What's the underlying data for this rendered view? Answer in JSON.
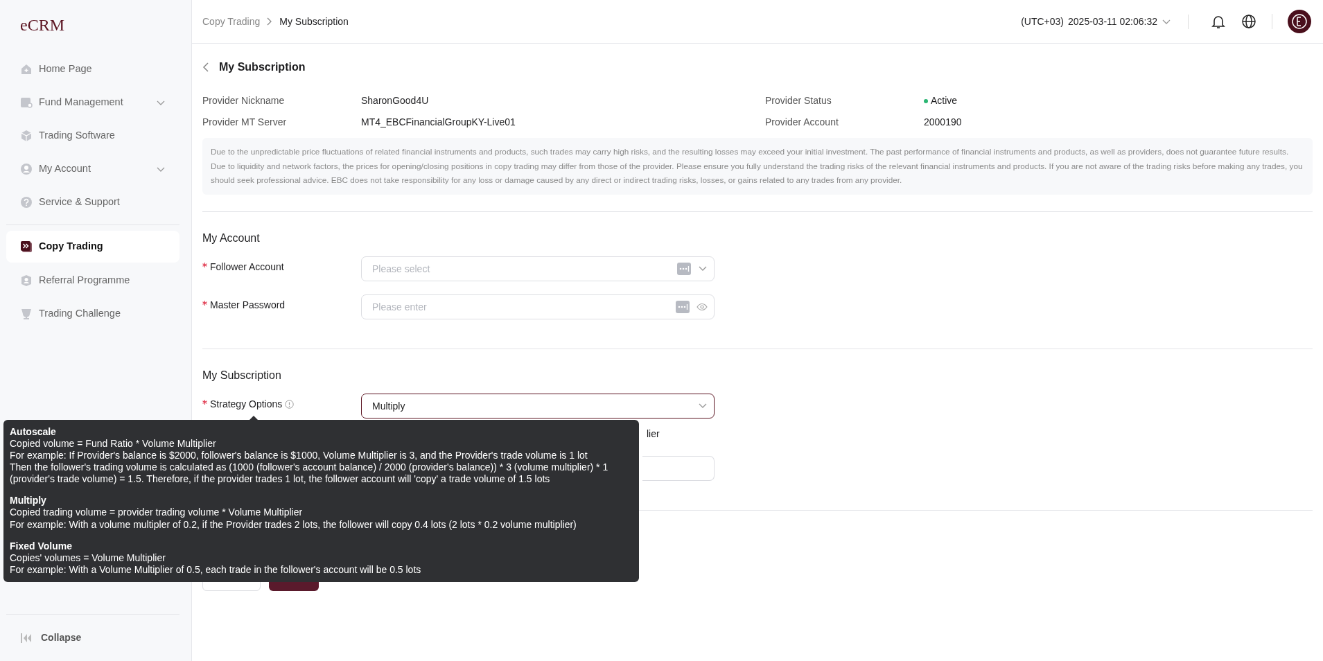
{
  "sidebar": {
    "logo": "eCRM",
    "items": [
      {
        "label": "Home Page",
        "expandable": false,
        "selected": false
      },
      {
        "label": "Fund Management",
        "expandable": true,
        "selected": false
      },
      {
        "label": "Trading Software",
        "expandable": false,
        "selected": false
      },
      {
        "label": "My Account",
        "expandable": true,
        "selected": false
      },
      {
        "label": "Service & Support",
        "expandable": false,
        "selected": false
      },
      {
        "label": "Copy Trading",
        "expandable": false,
        "selected": true
      },
      {
        "label": "Referral Programme",
        "expandable": false,
        "selected": false
      },
      {
        "label": "Trading Challenge",
        "expandable": false,
        "selected": false
      }
    ],
    "collapse": "Collapse"
  },
  "breadcrumb": [
    "Copy Trading",
    "My Subscription"
  ],
  "topbar": {
    "timezone": "(UTC+03)",
    "datetime": "2025-03-11 02:06:32"
  },
  "page_title": "My Subscription",
  "provider": [
    {
      "label": "Provider Nickname",
      "value": "SharonGood4U"
    },
    {
      "label": "Provider Status",
      "value": "Active",
      "color": "#2bb673"
    },
    {
      "label": "Provider MT Server",
      "value": "MT4_EBCFinancialGroupKY-Live01"
    },
    {
      "label": "Provider Account",
      "value": "2000190"
    }
  ],
  "disclaimer": "Due to the unpredictable price fluctuations of related financial instruments and products, such trades may carry high risks, and the resulting losses may exceed your initial investment. The past performance of financial instruments and products, as well as providers, does not guarantee future results. Due to liquidity and network factors, the prices for opening/closing positions in copy trading may differ from those of the provider. Please ensure you fully understand the trading risks of the relevant financial instruments and products. If you are not aware of the trading risks before making any trades, you should seek professional advice. EBC does not take responsibility for any loss or damage caused by any direct or indirect trading risks, losses, or gains related to any trades from any provider.",
  "account_section": {
    "title": "My Account",
    "fields": [
      {
        "label": "Follower Account",
        "kind": "select",
        "placeholder": "Please select",
        "focused": false
      },
      {
        "label": "Master Password",
        "kind": "password",
        "placeholder": "Please enter",
        "focused": false
      }
    ]
  },
  "subscription_section": {
    "title": "My Subscription",
    "strategy": {
      "label": "Strategy Options",
      "kind": "select",
      "value": "Multiply",
      "focused": true
    },
    "partial_text": "lier"
  },
  "tooltip": [
    {
      "title": "Autoscale",
      "lines": [
        "Copied volume = Fund Ratio * Volume Multiplier",
        "For example: If Provider's balance is $2000, follower's balance is $1000, Volume Multiplier is 3, and the Provider's trade volume is 1 lot",
        "Then the follower's trading volume is calculated as (1000 (follower's account balance) / 2000 (provider's balance)) * 3 (volume multiplier) * 1 (provider's trade volume) = 1.5. Therefore, if the provider trades 1 lot, the follower account will 'copy' a trade volume of 1.5 lots"
      ]
    },
    {
      "title": "Multiply",
      "lines": [
        "Copied trading volume = provider trading volume * Volume Multiplier",
        "For example: With a volume multipler of 0.2, if the Provider trades 2 lots, the follower will copy 0.4 lots (2 lots * 0.2 volume multiplier)"
      ]
    },
    {
      "title": "Fixed Volume",
      "lines": [
        "Copies' volumes = Volume Multiplier",
        "For example: With a Volume Multiplier of 0.5, each trade in the follower's account will be 0.5 lots"
      ]
    }
  ]
}
